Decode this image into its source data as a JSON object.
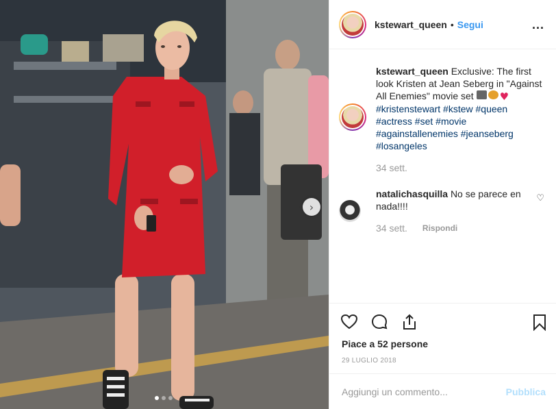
{
  "post": {
    "username": "kstewart_queen",
    "separator": "•",
    "follow_label": "Segui",
    "more_label": "...",
    "caption": {
      "username": "kstewart_queen",
      "text": "Exclusive: The first look Kristen at Jean Seberg in \"Against All Enemies\" movie set",
      "hashtags": [
        "#kristenstewart #kstew #queen",
        "#actress #set #movie",
        "#againstallenemies #jeanseberg",
        "#losangeles"
      ],
      "time": "34 sett."
    },
    "comment": {
      "username": "natalichasquilla",
      "text": "No se parece en nada!!!!",
      "time": "34 sett.",
      "reply_label": "Rispondi"
    },
    "likes": "Piace a 52 persone",
    "date": "29 LUGLIO 2018",
    "comment_placeholder": "Aggiungi un commento...",
    "publish_label": "Pubblica",
    "carousel": {
      "count": 3,
      "active": 0
    }
  },
  "colors": {
    "link_blue": "#3897f0",
    "hashtag": "#003569",
    "muted": "#999999",
    "publish_disabled": "#b2dffc",
    "dress_red": "#d11f2a"
  },
  "icons": [
    "heart-icon",
    "comment-icon",
    "share-icon",
    "bookmark-icon",
    "chevron-right-icon",
    "more-icon"
  ]
}
